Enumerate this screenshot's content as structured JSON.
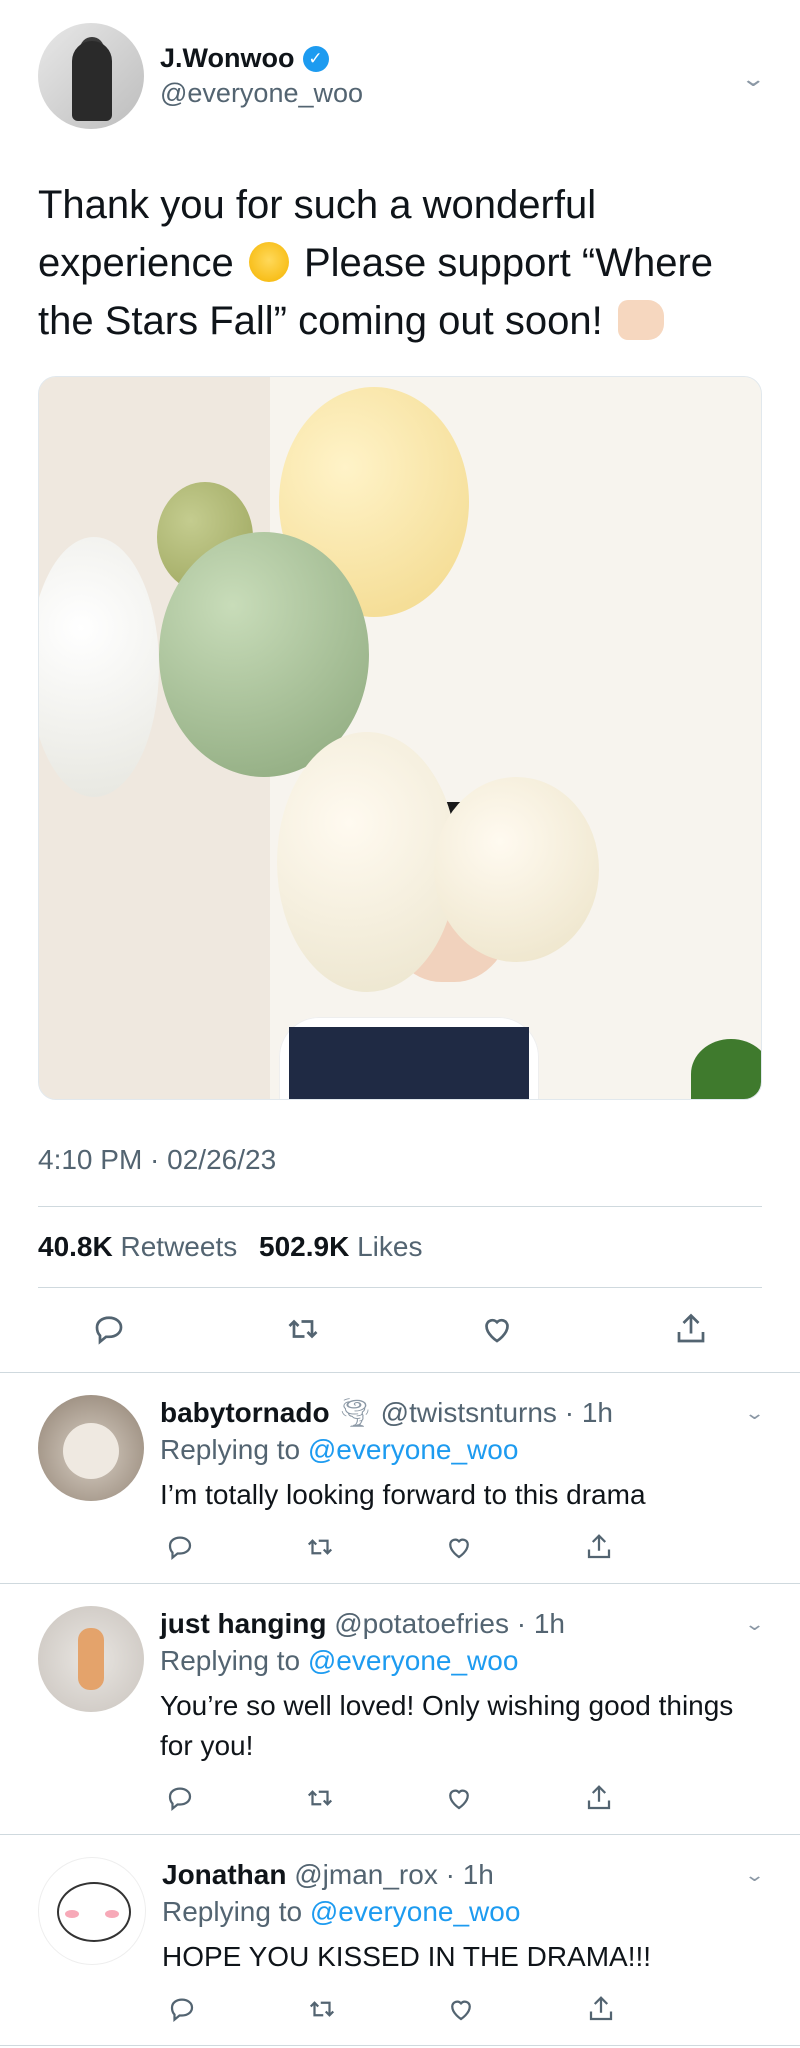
{
  "tweet": {
    "author_name": "J.Wonwoo",
    "author_handle": "@everyone_woo",
    "text_part1": "Thank you for such a wonderful experience",
    "text_part2": "Please support “Where the Stars Fall” coming out soon!",
    "timestamp": "4:10 PM · 02/26/23",
    "retweets_count": "40.8K",
    "retweets_label": "Retweets",
    "likes_count": "502.9K",
    "likes_label": "Likes",
    "icons": [
      "reply-icon",
      "retweet-icon",
      "like-icon",
      "share-icon"
    ]
  },
  "replies": [
    {
      "name": "babytornado",
      "handle": "@twistsnturns",
      "time": "1h",
      "replying_prefix": "Replying to",
      "replying_to": "@everyone_woo",
      "text": "I’m totally looking forward to this drama"
    },
    {
      "name": "just hanging",
      "handle": "@potatoefries",
      "time": "1h",
      "replying_prefix": "Replying to",
      "replying_to": "@everyone_woo",
      "text": "You’re so well loved! Only wishing good things for you!"
    },
    {
      "name": "Jonathan",
      "handle": "@jman_rox",
      "time": "1h",
      "replying_prefix": "Replying to",
      "replying_to": "@everyone_woo",
      "text": "HOPE YOU KISSED IN THE DRAMA!!!"
    }
  ],
  "colors": {
    "accent": "#1d9bf0",
    "muted": "#536471",
    "divider": "#cfd9de"
  }
}
